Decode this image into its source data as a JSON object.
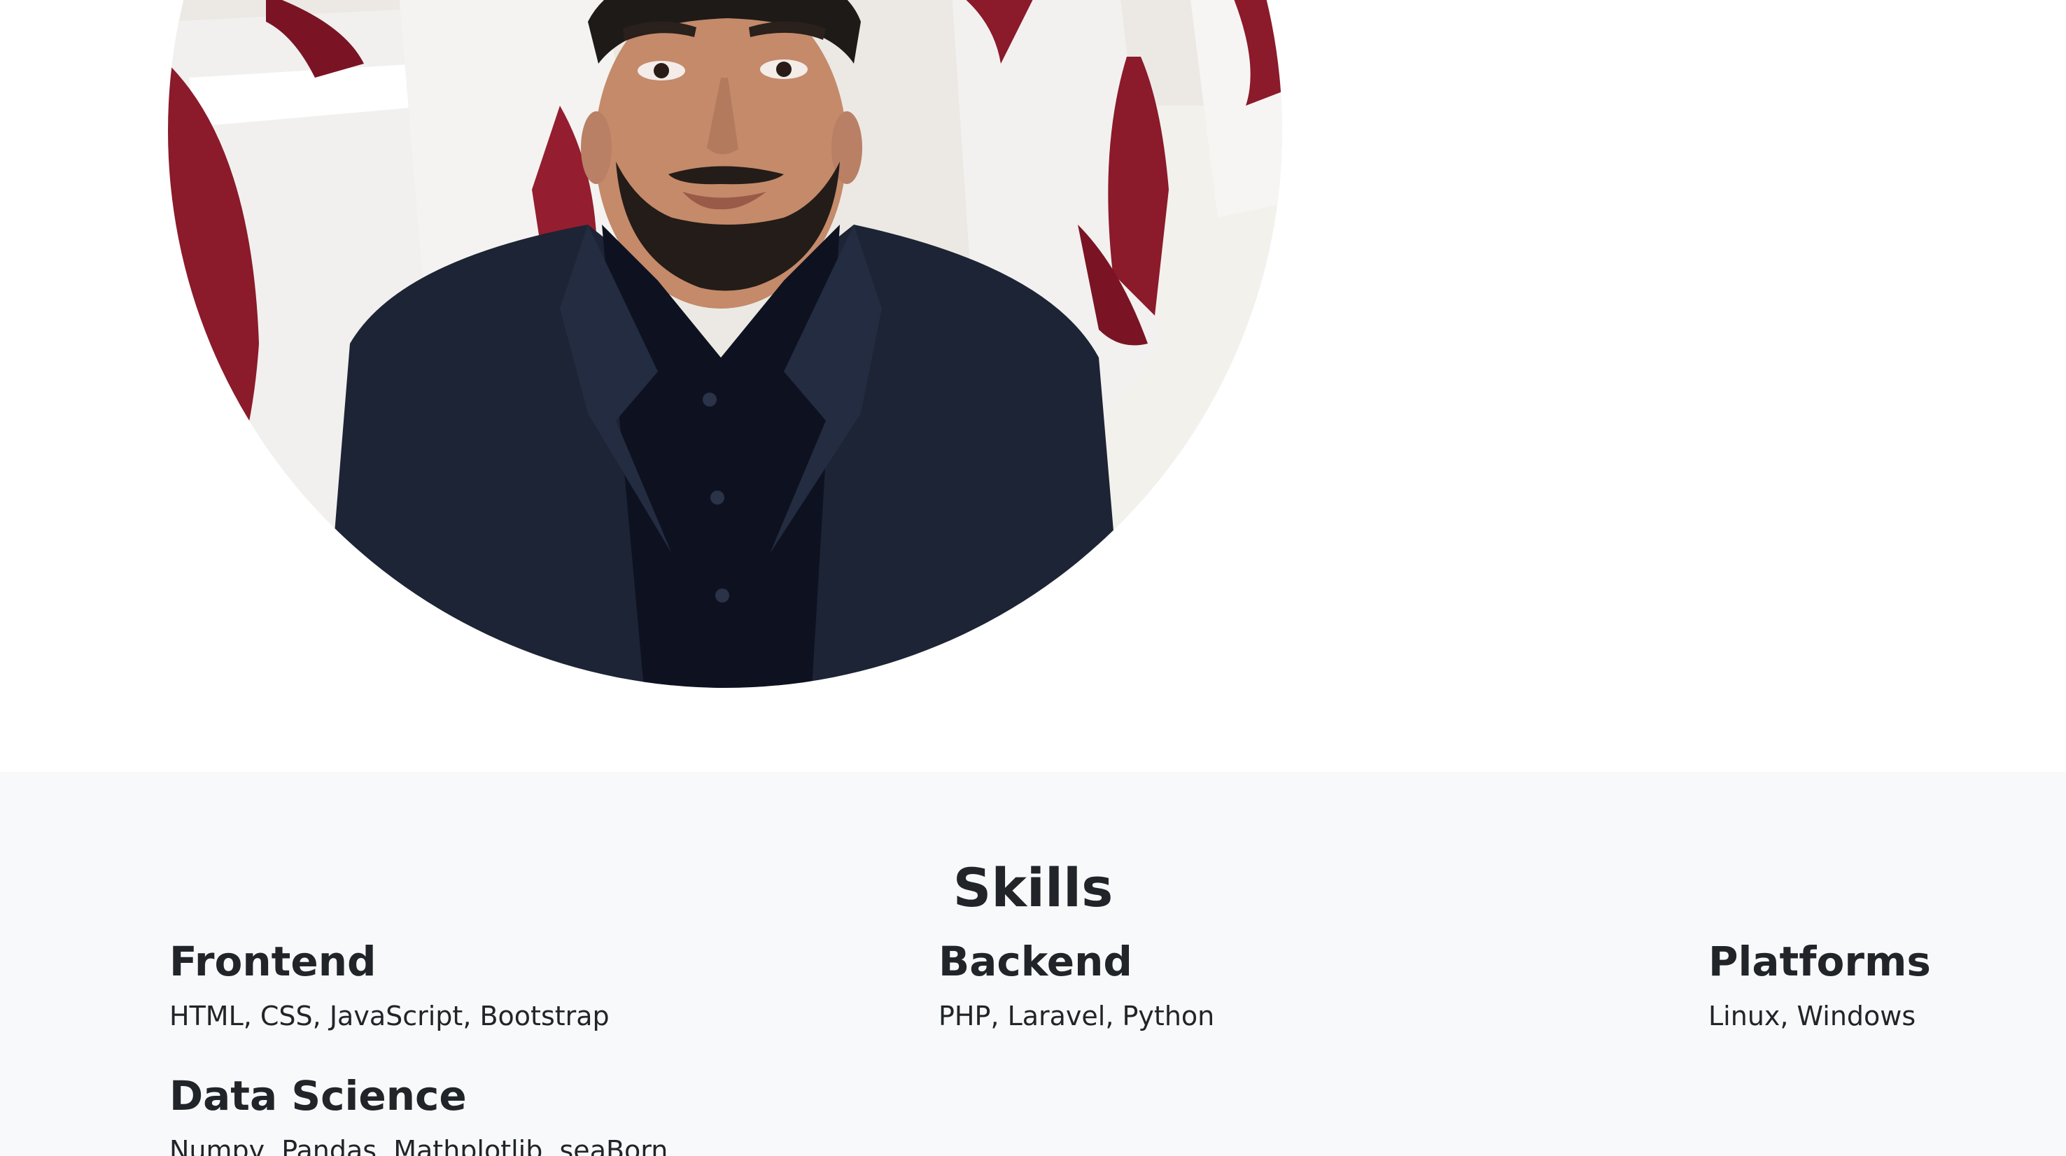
{
  "profile": {
    "photo_alt": "Profile photo"
  },
  "skills": {
    "title": "Skills",
    "items": [
      {
        "heading": "Frontend",
        "list": "HTML, CSS, JavaScript, Bootstrap"
      },
      {
        "heading": "Backend",
        "list": "PHP, Laravel, Python"
      },
      {
        "heading": "Platforms",
        "list": "Linux, Windows"
      },
      {
        "heading": "Data Science",
        "list": "Numpy, Pandas, Mathplotlib, seaBorn"
      }
    ]
  },
  "colors": {
    "page_bg": "#ffffff",
    "section_bg": "#f8f9fa",
    "text": "#212529",
    "chair_ribbon": "#8b1a2b",
    "suit": "#1c2435"
  }
}
